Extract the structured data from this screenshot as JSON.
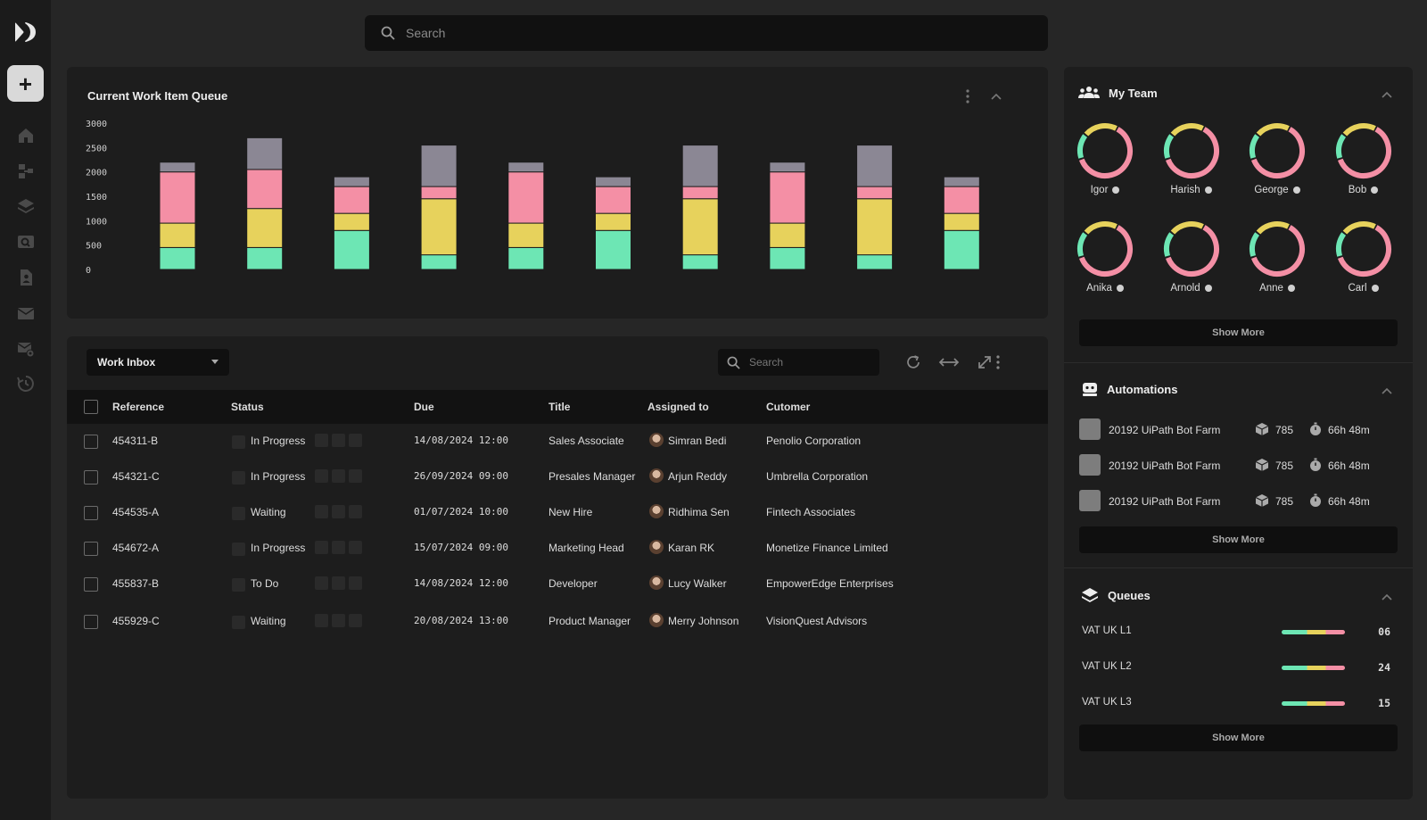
{
  "search": {
    "placeholder": "Search"
  },
  "rail": {
    "logo": "logo-icon",
    "add_label": "+",
    "nav_icons": [
      "home-icon",
      "hierarchy-icon",
      "layers-icon",
      "search-window-icon",
      "document-icon",
      "mail-icon",
      "mail-settings-icon",
      "history-icon"
    ]
  },
  "chart_panel": {
    "title": "Current Work Item Queue"
  },
  "chart_data": {
    "type": "bar",
    "stacked": true,
    "yticks": [
      "3000",
      "2500",
      "2000",
      "1500",
      "1000",
      "500",
      "0"
    ],
    "ylim": [
      0,
      3000
    ],
    "grid": false,
    "series": [
      {
        "color": "#6de6b4",
        "values": [
          450,
          450,
          800,
          300,
          450,
          800,
          300,
          450,
          300,
          800
        ]
      },
      {
        "color": "#e7d25c",
        "values": [
          500,
          800,
          350,
          1150,
          500,
          350,
          1150,
          500,
          1150,
          350
        ]
      },
      {
        "color": "#f48fa5",
        "values": [
          1050,
          800,
          550,
          250,
          1050,
          550,
          250,
          1050,
          250,
          550
        ]
      },
      {
        "color": "#8b8794",
        "values": [
          200,
          650,
          200,
          850,
          200,
          200,
          850,
          200,
          850,
          200
        ]
      }
    ]
  },
  "inbox": {
    "selector": "Work Inbox",
    "search_placeholder": "Search",
    "columns": {
      "reference": "Reference",
      "status": "Status",
      "due": "Due",
      "title": "Title",
      "assigned": "Assigned to",
      "customer": "Cutomer"
    },
    "rows": [
      {
        "reference": "454311-B",
        "status": "In Progress",
        "due": "14/08/2024 12:00",
        "title": "Sales Associate",
        "assigned": "Simran Bedi",
        "customer": "Penolio Corporation"
      },
      {
        "reference": "454321-C",
        "status": "In Progress",
        "due": "26/09/2024 09:00",
        "title": "Presales Manager",
        "assigned": "Arjun Reddy",
        "customer": "Umbrella Corporation"
      },
      {
        "reference": "454535-A",
        "status": "Waiting",
        "due": "01/07/2024 10:00",
        "title": "New Hire",
        "assigned": "Ridhima Sen",
        "customer": "Fintech Associates"
      },
      {
        "reference": "454672-A",
        "status": "In Progress",
        "due": "15/07/2024 09:00",
        "title": "Marketing Head",
        "assigned": "Karan RK",
        "customer": "Monetize Finance Limited"
      },
      {
        "reference": "455837-B",
        "status": "To Do",
        "due": "14/08/2024 12:00",
        "title": "Developer",
        "assigned": "Lucy Walker",
        "customer": "EmpowerEdge Enterprises"
      },
      {
        "reference": "455929-C",
        "status": "Waiting",
        "due": "20/08/2024 13:00",
        "title": "Product Manager",
        "assigned": "Merry Johnson",
        "customer": "VisionQuest Advisors"
      }
    ]
  },
  "team": {
    "title": "My Team",
    "members": [
      {
        "name": "Igor"
      },
      {
        "name": "Harish"
      },
      {
        "name": "George"
      },
      {
        "name": "Bob"
      },
      {
        "name": "Anika"
      },
      {
        "name": "Arnold"
      },
      {
        "name": "Anne"
      },
      {
        "name": "Carl"
      }
    ],
    "show_more": "Show More",
    "ring_colors": {
      "pink": "#f48fa5",
      "yellow": "#e7d25c",
      "green": "#6de6b4"
    }
  },
  "automations": {
    "title": "Automations",
    "items": [
      {
        "name": "20192 UiPath Bot Farm",
        "count": "785",
        "time": "66h 48m"
      },
      {
        "name": "20192 UiPath Bot Farm",
        "count": "785",
        "time": "66h 48m"
      },
      {
        "name": "20192 UiPath Bot Farm",
        "count": "785",
        "time": "66h 48m"
      }
    ],
    "show_more": "Show More"
  },
  "queues": {
    "title": "Queues",
    "items": [
      {
        "name": "VAT UK L1",
        "count": "06"
      },
      {
        "name": "VAT UK L2",
        "count": "24"
      },
      {
        "name": "VAT UK L3",
        "count": "15"
      }
    ],
    "show_more": "Show More"
  }
}
